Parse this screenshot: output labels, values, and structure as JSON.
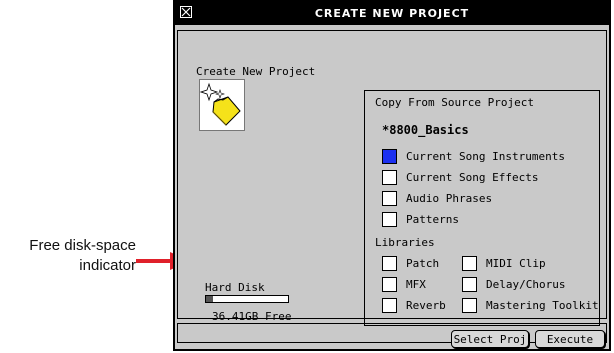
{
  "annotation": {
    "line1": "Free disk-space",
    "line2": "indicator"
  },
  "window": {
    "title": "CREATE NEW PROJECT"
  },
  "left_panel": {
    "label": "Create New Project",
    "hard_disk_label": "Hard Disk",
    "free_space": "36.41GB Free",
    "disk_used_fraction": 0.08
  },
  "source": {
    "heading": "Copy From Source Project",
    "project_name": "*8800_Basics",
    "options": [
      {
        "label": "Current Song Instruments",
        "checked": true
      },
      {
        "label": "Current Song Effects",
        "checked": false
      },
      {
        "label": "Audio Phrases",
        "checked": false
      },
      {
        "label": "Patterns",
        "checked": false
      }
    ],
    "libraries_heading": "Libraries",
    "libraries": [
      {
        "label": "Patch",
        "checked": false
      },
      {
        "label": "MIDI Clip",
        "checked": false
      },
      {
        "label": "MFX",
        "checked": false
      },
      {
        "label": "Delay/Chorus",
        "checked": false
      },
      {
        "label": "Reverb",
        "checked": false
      },
      {
        "label": "Mastering Toolkit",
        "checked": false
      }
    ]
  },
  "buttons": {
    "select_proj": "Select Proj",
    "execute": "Execute"
  },
  "colors": {
    "checked": "#1b30f0",
    "window_bg": "#c9c9c9",
    "arrow": "#e0202a",
    "icon_folder": "#f5e21a"
  }
}
